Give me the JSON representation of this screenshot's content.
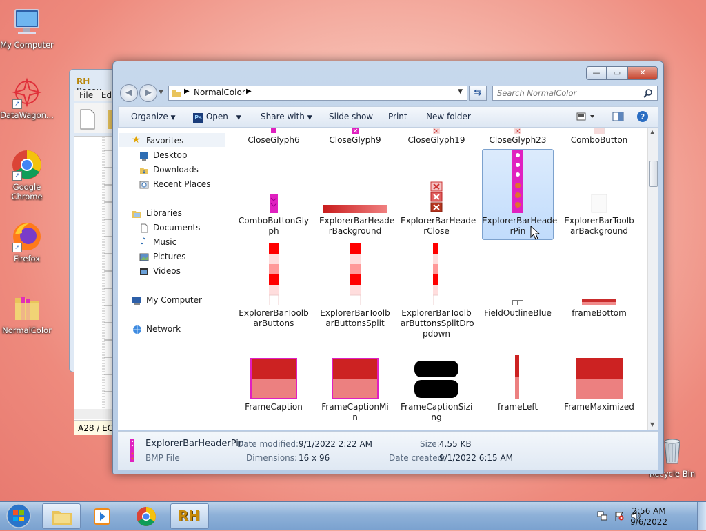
{
  "desktop": {
    "icons": [
      {
        "label": "My Computer"
      },
      {
        "label": "DataWagon..."
      },
      {
        "label": "Google Chrome"
      },
      {
        "label": "Firefox"
      },
      {
        "label": "NormalColor"
      },
      {
        "label": "Recycle Bin"
      }
    ]
  },
  "background_window": {
    "title": "Resou",
    "menu": [
      "File",
      "Edi"
    ],
    "cell_ref": "A28 / EC"
  },
  "explorer": {
    "address": {
      "path": "NormalColor"
    },
    "search": {
      "placeholder": "Search NormalColor"
    },
    "caption": {
      "minimize": "—",
      "maximize": "▭",
      "close": "✕"
    },
    "commands": {
      "organize": "Organize",
      "open": "Open",
      "share_with": "Share with",
      "slide_show": "Slide show",
      "print": "Print",
      "new_folder": "New folder"
    },
    "nav": {
      "favorites": "Favorites",
      "desktop": "Desktop",
      "downloads": "Downloads",
      "recent_places": "Recent Places",
      "libraries": "Libraries",
      "documents": "Documents",
      "music": "Music",
      "pictures": "Pictures",
      "videos": "Videos",
      "my_computer": "My Computer",
      "network": "Network"
    },
    "files": [
      {
        "line1": "CloseGlyph6",
        "line2": ""
      },
      {
        "line1": "CloseGlyph9",
        "line2": ""
      },
      {
        "line1": "CloseGlyph19",
        "line2": ""
      },
      {
        "line1": "CloseGlyph23",
        "line2": ""
      },
      {
        "line1": "ComboButton",
        "line2": ""
      },
      {
        "line1": "ComboButtonGly",
        "line2": "ph"
      },
      {
        "line1": "ExplorerBarHeade",
        "line2": "rBackground"
      },
      {
        "line1": "ExplorerBarHeade",
        "line2": "rClose"
      },
      {
        "line1": "ExplorerBarHeade",
        "line2": "rPin"
      },
      {
        "line1": "ExplorerBarToolb",
        "line2": "arBackground"
      },
      {
        "line1": "ExplorerBarToolb",
        "line2": "arButtons"
      },
      {
        "line1": "ExplorerBarToolb",
        "line2": "arButtonsSplit"
      },
      {
        "line1": "ExplorerBarToolb",
        "line2": "arButtonsSplitDro",
        "line3": "pdown"
      },
      {
        "line1": "FieldOutlineBlue",
        "line2": ""
      },
      {
        "line1": "frameBottom",
        "line2": ""
      },
      {
        "line1": "FrameCaption",
        "line2": ""
      },
      {
        "line1": "FrameCaptionMi",
        "line2": "n"
      },
      {
        "line1": "FrameCaptionSizi",
        "line2": "ng"
      },
      {
        "line1": "frameLeft",
        "line2": ""
      },
      {
        "line1": "FrameMaximized",
        "line2": ""
      }
    ],
    "details": {
      "name": "ExplorerBarHeaderPin",
      "type": "BMP File",
      "date_modified_label": "Date modified:",
      "date_modified": "9/1/2022 2:22 AM",
      "dimensions_label": "Dimensions:",
      "dimensions": "16 x 96",
      "size_label": "Size:",
      "size": "4.55 KB",
      "date_created_label": "Date created:",
      "date_created": "9/1/2022 6:15 AM"
    }
  },
  "taskbar": {
    "clock_time": "2:56 AM",
    "clock_date": "9/6/2022",
    "rh_label": "RH"
  },
  "colors": {
    "accent": "#cc2222",
    "magenta": "#e020c0",
    "selection": "#c1dcfc"
  }
}
